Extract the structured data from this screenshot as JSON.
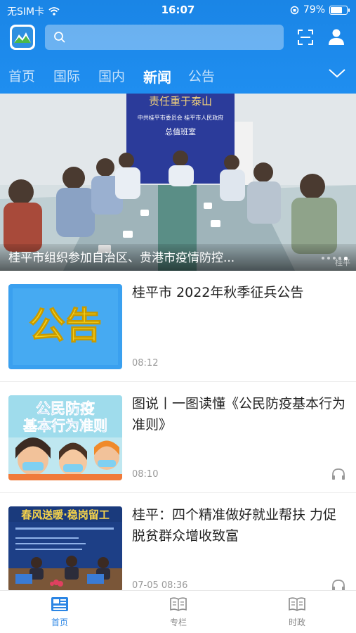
{
  "status": {
    "carrier": "无SIM卡",
    "time": "16:07",
    "battery": "79%",
    "battery_fraction": 0.79
  },
  "colors": {
    "brand": "#1f8ef0",
    "active_nav": "#2b85e4"
  },
  "search": {
    "placeholder": ""
  },
  "tabs": [
    {
      "label": "首页",
      "active": false
    },
    {
      "label": "国际",
      "active": false
    },
    {
      "label": "国内",
      "active": false
    },
    {
      "label": "新闻",
      "active": true
    },
    {
      "label": "公告",
      "active": false
    }
  ],
  "banner": {
    "caption": "桂平市组织参加自治区、贵港市疫情防控...",
    "sign_title": "责任重于泰山",
    "sign_org": "中共桂平市委员会  桂平市人民政府",
    "sign_office": "总值班室",
    "watermark": "桂平",
    "slides": 5,
    "current_slide": 5
  },
  "news": [
    {
      "title": "桂平市 2022年秋季征兵公告",
      "time": "08:12",
      "has_audio": false,
      "thumb_text": "公告"
    },
    {
      "title": "图说丨一图读懂《公民防疫基本行为准则》",
      "time": "08:10",
      "has_audio": true,
      "thumb_text_1": "公民防疫",
      "thumb_text_2": "基本行为准则"
    },
    {
      "title": "桂平：四个精准做好就业帮扶 力促脱贫群众增收致富",
      "time": "07-05 08:36",
      "has_audio": true,
      "thumb_text": "春风送暖·稳岗留工"
    }
  ],
  "bottom_nav": [
    {
      "label": "首页",
      "icon": "home-news-icon",
      "active": true
    },
    {
      "label": "专栏",
      "icon": "book-icon",
      "active": false
    },
    {
      "label": "时政",
      "icon": "book-icon",
      "active": false
    }
  ]
}
